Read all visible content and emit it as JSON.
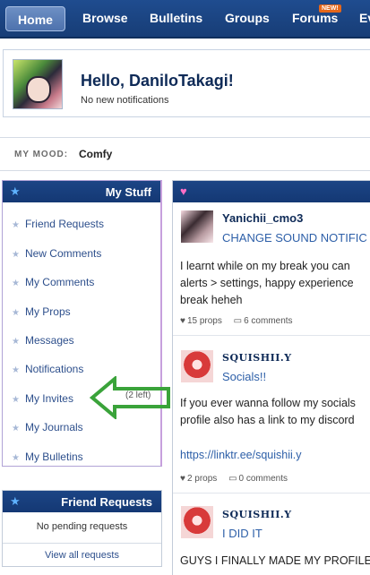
{
  "nav": {
    "items": [
      "Home",
      "Browse",
      "Bulletins",
      "Groups",
      "Forums",
      "Ev"
    ],
    "new_badge": "NEW!"
  },
  "profile": {
    "greeting": "Hello, DaniloTakagi!",
    "notifications": "No new notifications"
  },
  "mood": {
    "label": "MY MOOD:",
    "value": "Comfy"
  },
  "my_stuff": {
    "title": "My Stuff",
    "items": [
      "Friend Requests",
      "New Comments",
      "My Comments",
      "My Props",
      "Messages",
      "Notifications",
      "My Invites",
      "My Journals",
      "My Bulletins"
    ],
    "invites_count": "(2 left)"
  },
  "friend_requests": {
    "title": "Friend Requests",
    "empty": "No pending requests",
    "view_all": "View all requests"
  },
  "feed": {
    "posts": [
      {
        "user": "Yanichii_cmo3",
        "title": "CHANGE SOUND NOTIFIC",
        "body": [
          "I learnt while on my break you can",
          "alerts > settings, happy experience",
          "break heheh"
        ],
        "props": "15 props",
        "comments": "6 comments"
      },
      {
        "user": "SQUISHII.Y",
        "title": "Socials!!",
        "body": [
          "If you ever wanna follow my socials",
          "profile also has a link to my discord"
        ],
        "link": "https://linktr.ee/squishii.y",
        "props": "2 props",
        "comments": "0 comments"
      },
      {
        "user": "SQUISHII.Y",
        "title": "I DID IT",
        "body": [
          "GUYS I FINALLY MADE MY PROFILE"
        ]
      }
    ]
  },
  "colors": {
    "nav_bg": "#1f4c8f",
    "panel_head": "#1c4585",
    "link": "#2d4f8c",
    "arrow": "#3aa33a",
    "badge": "#e6671a"
  }
}
